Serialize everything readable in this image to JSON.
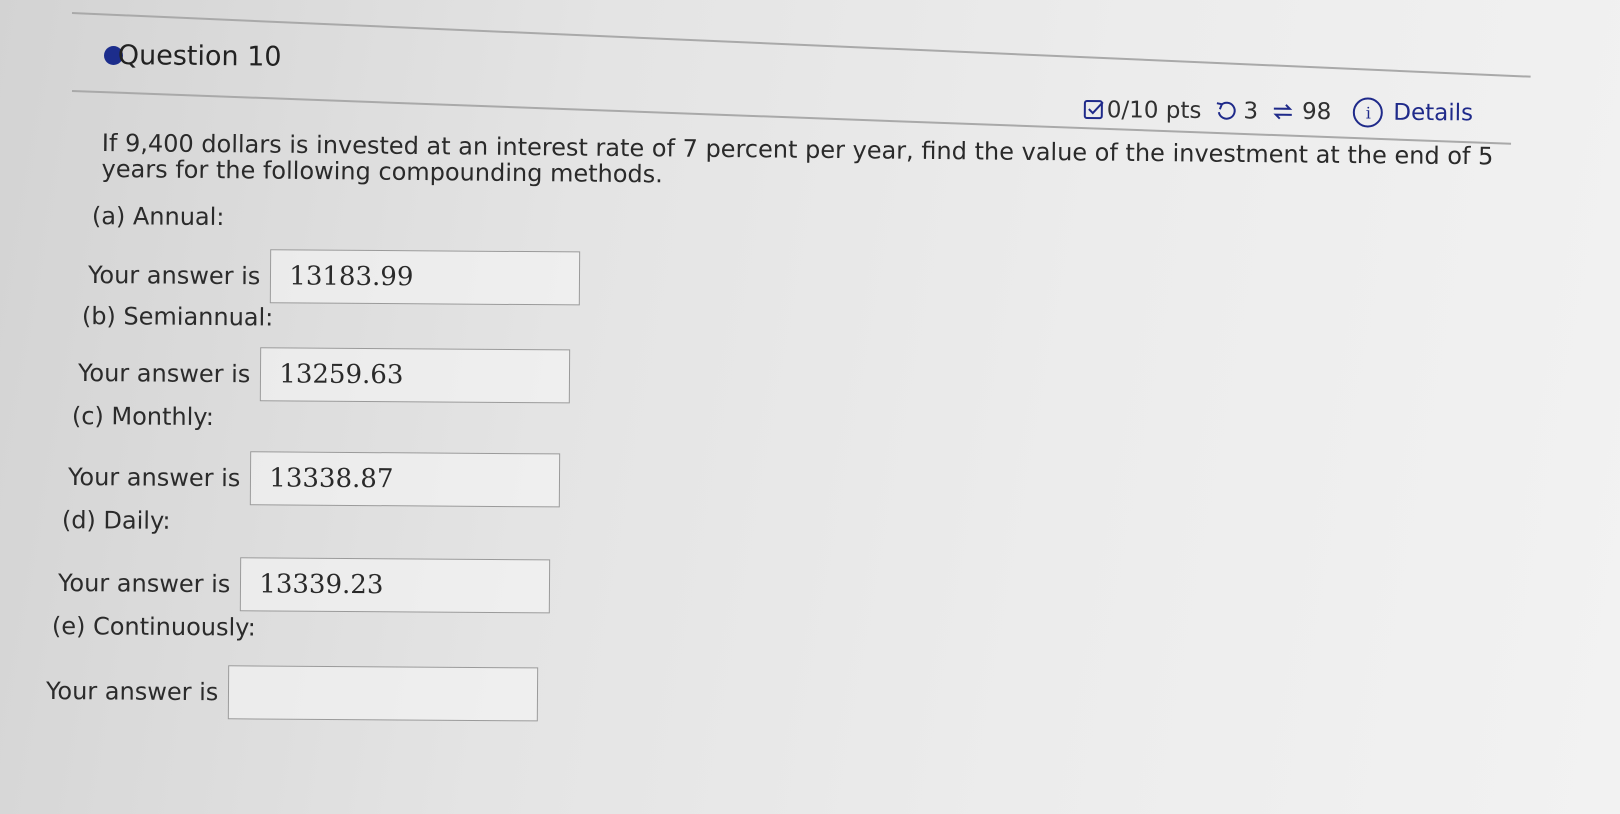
{
  "question": {
    "title": "Question 10",
    "score": "0/10 pts",
    "retries": "3",
    "submissions": "98",
    "details_label": "Details",
    "score_icon": "checkbox-icon",
    "retry_icon": "undo-icon",
    "submissions_icon": "swap-arrows-icon",
    "info_icon": "info-icon",
    "text": "If 9,400 dollars is invested at an interest rate of 7 percent per year, find the value of the investment at the end of 5 years for the following compounding methods."
  },
  "parts": [
    {
      "label": "(a) Annual:",
      "answer_prefix": "Your answer is",
      "value": "13183.99"
    },
    {
      "label": "(b) Semiannual:",
      "answer_prefix": "Your answer is",
      "value": "13259.63"
    },
    {
      "label": "(c) Monthly:",
      "answer_prefix": "Your answer is",
      "value": "13338.87"
    },
    {
      "label": "(d) Daily:",
      "answer_prefix": "Your answer is",
      "value": "13339.23"
    },
    {
      "label": "(e) Continuously:",
      "answer_prefix": "Your answer is",
      "value": ""
    }
  ],
  "colors": {
    "accent": "#1f2a8a",
    "bullet": "#1c2d8c"
  }
}
